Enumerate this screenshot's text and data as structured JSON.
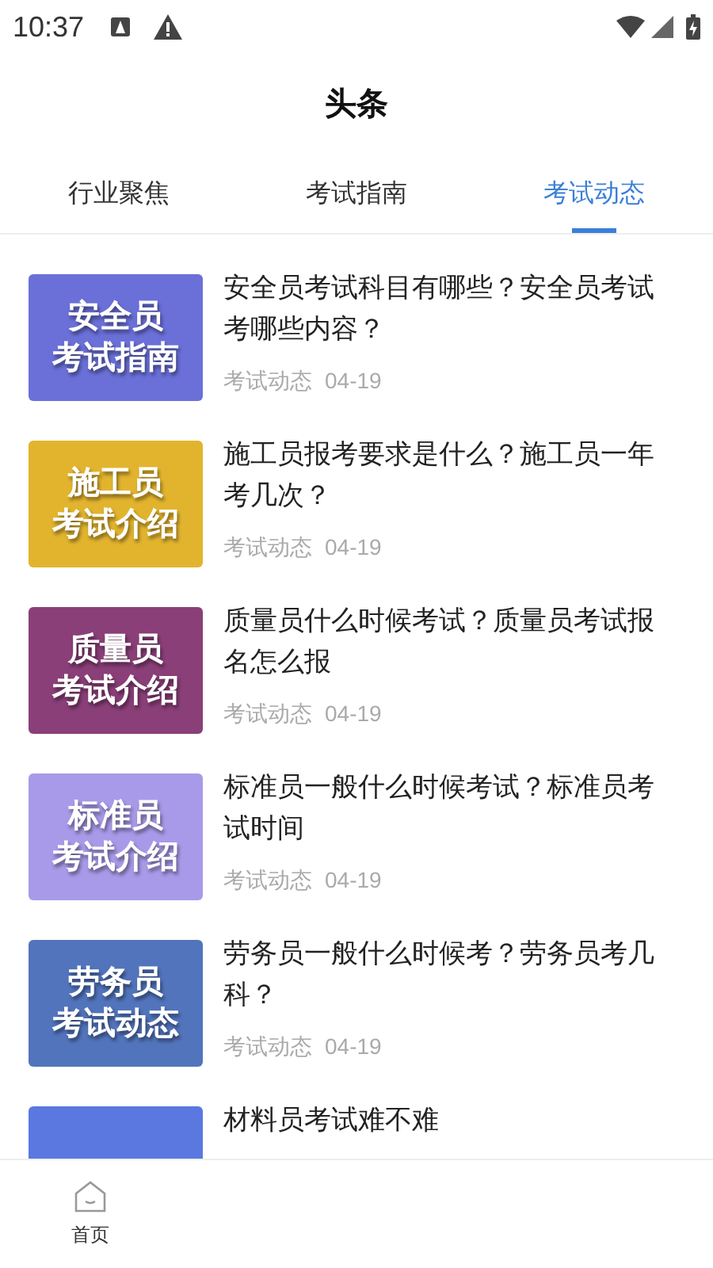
{
  "status_bar": {
    "time": "10:37"
  },
  "header": {
    "title": "头条"
  },
  "tabs": [
    {
      "label": "行业聚焦",
      "selected": false
    },
    {
      "label": "考试指南",
      "selected": false
    },
    {
      "label": "考试动态",
      "selected": true
    }
  ],
  "articles": [
    {
      "thumb_lines": [
        "安全员",
        "考试指南"
      ],
      "color": "#6a70d8",
      "title": "安全员考试科目有哪些？安全员考试考哪些内容？",
      "category": "考试动态",
      "date": "04-19"
    },
    {
      "thumb_lines": [
        "施工员",
        "考试介绍"
      ],
      "color": "#e2b42e",
      "title": "施工员报考要求是什么？施工员一年考几次？",
      "category": "考试动态",
      "date": "04-19"
    },
    {
      "thumb_lines": [
        "质量员",
        "考试介绍"
      ],
      "color": "#8a3f78",
      "title": "质量员什么时候考试？质量员考试报名怎么报",
      "category": "考试动态",
      "date": "04-19"
    },
    {
      "thumb_lines": [
        "标准员",
        "考试介绍"
      ],
      "color": "#a89ae8",
      "title": "标准员一般什么时候考试？标准员考试时间",
      "category": "考试动态",
      "date": "04-19"
    },
    {
      "thumb_lines": [
        "劳务员",
        "考试动态"
      ],
      "color": "#5274bc",
      "title": "劳务员一般什么时候考？劳务员考几科？",
      "category": "考试动态",
      "date": "04-19"
    },
    {
      "color": "#5a78e0",
      "title": "材料员考试难不难"
    }
  ],
  "bottom_nav": [
    {
      "label": "首页"
    }
  ]
}
